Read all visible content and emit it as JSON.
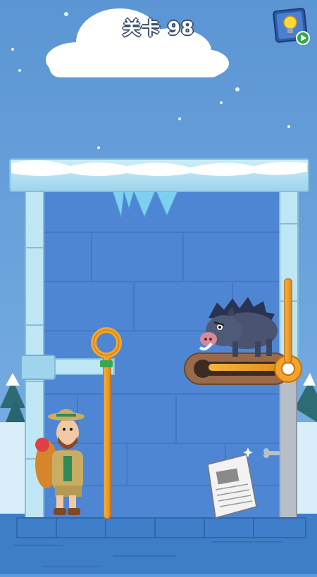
{
  "header": {
    "level_title": "关卡 98"
  },
  "hint_button": {
    "icon": "lightbulb-icon",
    "badge_icon": "play-video-icon"
  },
  "colors": {
    "sky": "#5f9bd8",
    "ice_wall": "#4f86d4",
    "ice_frame": "#bfe6f4",
    "pin_gold": "#f3a52a",
    "floor": "#3f7fc9"
  },
  "game": {
    "pins": [
      "vertical-pin-left",
      "horizontal-pin-right",
      "vertical-pin-right"
    ],
    "characters": [
      "explorer",
      "wild-boar"
    ],
    "items": [
      "newspaper"
    ]
  }
}
